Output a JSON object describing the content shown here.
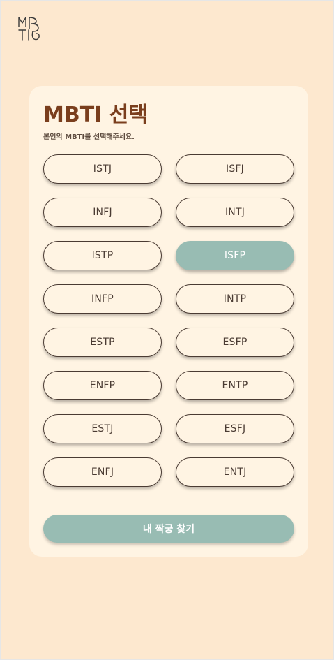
{
  "logo": {
    "icon": "mbti-logo-icon",
    "letters": [
      "M",
      "B",
      "T",
      "I"
    ]
  },
  "card": {
    "title": "MBTI 선택",
    "subtitle": "본인의 MBTI를 선택해주세요."
  },
  "mbti_types": [
    {
      "label": "ISTJ",
      "selected": false
    },
    {
      "label": "ISFJ",
      "selected": false
    },
    {
      "label": "INFJ",
      "selected": false
    },
    {
      "label": "INTJ",
      "selected": false
    },
    {
      "label": "ISTP",
      "selected": false
    },
    {
      "label": "ISFP",
      "selected": true
    },
    {
      "label": "INFP",
      "selected": false
    },
    {
      "label": "INTP",
      "selected": false
    },
    {
      "label": "ESTP",
      "selected": false
    },
    {
      "label": "ESFP",
      "selected": false
    },
    {
      "label": "ENFP",
      "selected": false
    },
    {
      "label": "ENTP",
      "selected": false
    },
    {
      "label": "ESTJ",
      "selected": false
    },
    {
      "label": "ESFJ",
      "selected": false
    },
    {
      "label": "ENFJ",
      "selected": false
    },
    {
      "label": "ENTJ",
      "selected": false
    }
  ],
  "submit_label": "내 짝궁 찾기",
  "colors": {
    "background": "#fde8cf",
    "card": "#fff4e3",
    "accent": "#98bcb3",
    "title": "#7a3e1d",
    "text": "#4a3b33"
  }
}
